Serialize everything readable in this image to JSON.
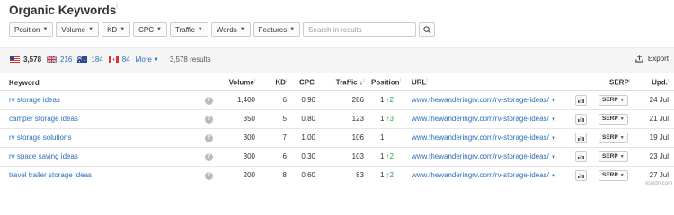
{
  "header": {
    "title": "Organic Keywords",
    "info": "i"
  },
  "filters": [
    {
      "label": "Position"
    },
    {
      "label": "Volume"
    },
    {
      "label": "KD"
    },
    {
      "label": "CPC"
    },
    {
      "label": "Traffic"
    },
    {
      "label": "Words"
    },
    {
      "label": "Features"
    }
  ],
  "search": {
    "placeholder": "Search in results",
    "value": ""
  },
  "countries": [
    {
      "flag": "us-flag",
      "count": "3,578"
    },
    {
      "flag": "gb-flag",
      "count": "216"
    },
    {
      "flag": "au-flag",
      "count": "184"
    },
    {
      "flag": "ca-flag",
      "count": "84"
    }
  ],
  "more_label": "More",
  "results_label": "3,578 results",
  "export_label": "Export",
  "columns": {
    "keyword": "Keyword",
    "volume": "Volume",
    "kd": "KD",
    "cpc": "CPC",
    "traffic": "Traffic",
    "traffic_sort": "↓",
    "position": "Position",
    "url": "URL",
    "serp": "SERP",
    "upd": "Upd."
  },
  "rows": [
    {
      "keyword": "rv storage ideas",
      "volume": "1,400",
      "kd": "6",
      "cpc": "0.90",
      "traffic": "286",
      "position": "1",
      "change": "↑2",
      "url": "www.thewanderingrv.com/rv-storage-ideas/",
      "serp": "SERP",
      "updated": "24 Jul"
    },
    {
      "keyword": "camper storage ideas",
      "volume": "350",
      "kd": "5",
      "cpc": "0.80",
      "traffic": "123",
      "position": "1",
      "change": "↑3",
      "url": "www.thewanderingrv.com/rv-storage-ideas/",
      "serp": "SERP",
      "updated": "21 Jul"
    },
    {
      "keyword": "rv storage solutions",
      "volume": "300",
      "kd": "7",
      "cpc": "1.00",
      "traffic": "106",
      "position": "1",
      "change": "",
      "url": "www.thewanderingrv.com/rv-storage-ideas/",
      "serp": "SERP",
      "updated": "19 Jul"
    },
    {
      "keyword": "rv space saving ideas",
      "volume": "300",
      "kd": "6",
      "cpc": "0.30",
      "traffic": "103",
      "position": "1",
      "change": "↑2",
      "url": "www.thewanderingrv.com/rv-storage-ideas/",
      "serp": "SERP",
      "updated": "23 Jul"
    },
    {
      "keyword": "travel trailer storage ideas",
      "volume": "200",
      "kd": "8",
      "cpc": "0.60",
      "traffic": "83",
      "position": "1",
      "change": "↑2",
      "url": "www.thewanderingrv.com/rv-storage-ideas/",
      "serp": "SERP",
      "updated": "27 Jul"
    }
  ],
  "watermark": "wsxdn.com",
  "colors": {
    "link": "#2a6ebb",
    "up": "#2e9e44",
    "band": "#f5f5f5"
  }
}
